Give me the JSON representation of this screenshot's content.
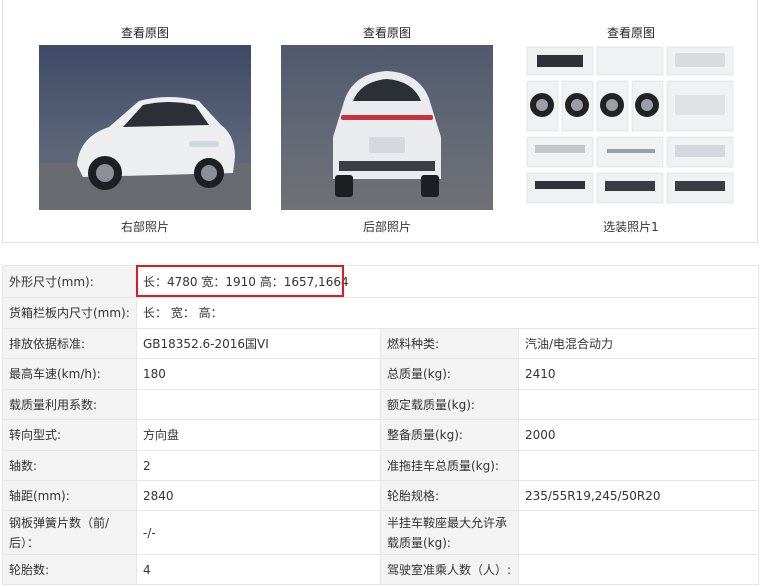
{
  "photos": [
    {
      "link": "查看原图",
      "caption": "右部照片",
      "icon": "car-front-side-photo"
    },
    {
      "link": "查看原图",
      "caption": "后部照片",
      "icon": "car-rear-photo"
    },
    {
      "link": "查看原图",
      "caption": "选装照片1",
      "icon": "car-options-collage-photo"
    }
  ],
  "dims": {
    "label": "外形尺寸(mm):",
    "value": "长：4780 宽：1910 高：1657,1664"
  },
  "cargo": {
    "label": "货箱栏板内尺寸(mm):",
    "value": "长：  宽：  高："
  },
  "rows": [
    {
      "l1": "排放依据标准:",
      "v1": "GB18352.6-2016国VI",
      "l2": "燃料种类:",
      "v2": "汽油/电混合动力"
    },
    {
      "l1": "最高车速(km/h):",
      "v1": "180",
      "l2": "总质量(kg):",
      "v2": "2410"
    },
    {
      "l1": "载质量利用系数:",
      "v1": "",
      "l2": "额定载质量(kg):",
      "v2": ""
    },
    {
      "l1": "转向型式:",
      "v1": "方向盘",
      "l2": "整备质量(kg):",
      "v2": "2000"
    },
    {
      "l1": "轴数:",
      "v1": "2",
      "l2": "准拖挂车总质量(kg):",
      "v2": ""
    },
    {
      "l1": "轴距(mm):",
      "v1": "2840",
      "l2": "轮胎规格:",
      "v2": "235/55R19,245/50R20"
    },
    {
      "l1": "钢板弹簧片数（前/后）：",
      "v1": "-/-",
      "l2": "半挂车鞍座最大允许承载质量(kg):",
      "v2": ""
    },
    {
      "l1": "轮胎数:",
      "v1": "4",
      "l2": "驾驶室准乘人数（人）:",
      "v2": ""
    }
  ],
  "colors": {
    "highlight": "#e01b1b",
    "label_bg": "#f3f3f3",
    "border": "#e6e6e6"
  }
}
